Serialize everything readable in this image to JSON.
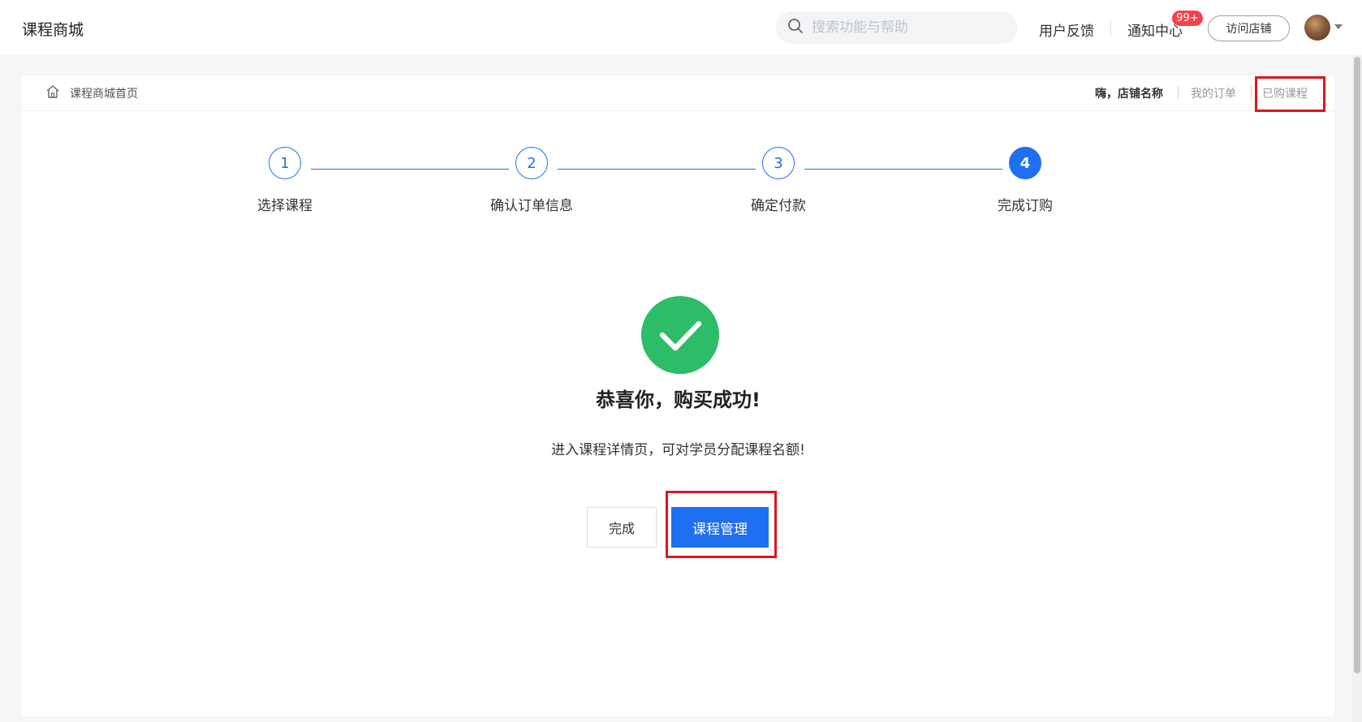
{
  "header": {
    "app_title": "课程商城",
    "search_placeholder": "搜索功能与帮助",
    "feedback": "用户反馈",
    "notifications": "通知中心",
    "notification_badge": "99+",
    "visit_store": "访问店铺"
  },
  "subbar": {
    "home_crumb": "课程商城首页",
    "greeting": "嗨，店铺名称",
    "my_orders": "我的订单",
    "purchased_courses": "已购课程"
  },
  "steps": [
    {
      "number": "1",
      "label": "选择课程"
    },
    {
      "number": "2",
      "label": "确认订单信息"
    },
    {
      "number": "3",
      "label": "确定付款"
    },
    {
      "number": "4",
      "label": "完成订购"
    }
  ],
  "success": {
    "title": "恭喜你，购买成功!",
    "description": "进入课程详情页，可对学员分配课程名额!",
    "done_button": "完成",
    "manage_button": "课程管理"
  },
  "colors": {
    "primary": "#1f6ff1",
    "success": "#2dbc67",
    "highlight": "#e0141c",
    "badge": "#f5414a"
  }
}
